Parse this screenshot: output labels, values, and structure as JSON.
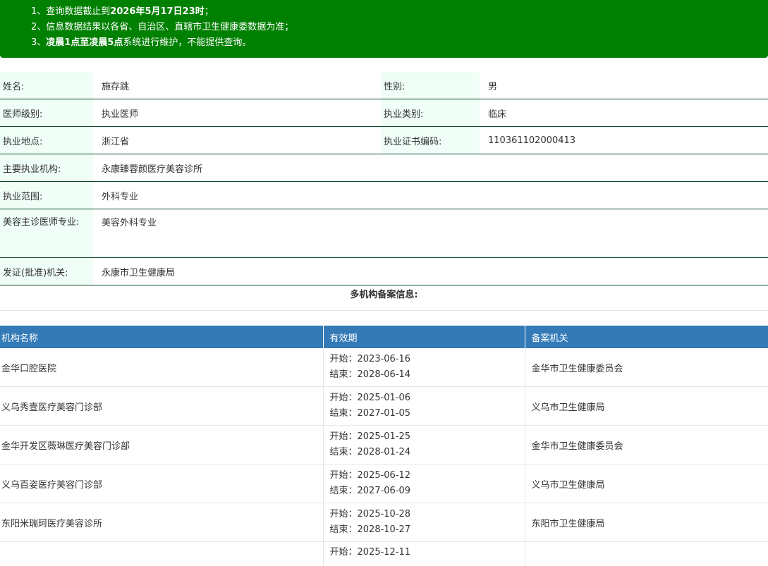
{
  "notice": {
    "line1_prefix": "1、查询数据截止到",
    "line1_bold": "2026年5月17日23时",
    "line1_suffix": "；",
    "line2": "2、信息数据结果以各省、自治区、直辖市卫生健康委数据为准；",
    "line3_prefix": "3、",
    "line3_bold": "凌晨1点至凌晨5点",
    "line3_suffix": "系统进行维护，不能提供查询。"
  },
  "doctor": {
    "name_label": "姓名:",
    "name": "施存跳",
    "gender_label": "性别:",
    "gender": "男",
    "level_label": "医师级别:",
    "level": "执业医师",
    "category_label": "执业类别:",
    "category": "临床",
    "location_label": "执业地点:",
    "location": "浙江省",
    "cert_label": "执业证书编码:",
    "cert": "110361102000413",
    "institution_label": "主要执业机构:",
    "institution": "永康臻蓉颜医疗美容诊所",
    "scope_label": "执业范围:",
    "scope": "外科专业",
    "cosmetic_label": "美容主诊医师专业:",
    "cosmetic": "美容外科专业",
    "issuer_label": "发证(批准)机关:",
    "issuer": "永康市卫生健康局"
  },
  "multi": {
    "title": "多机构备案信息:",
    "headers": {
      "name": "机构名称",
      "period": "有效期",
      "authority": "备案机关"
    },
    "rows": [
      {
        "name": "金华口腔医院",
        "start": "开始：2023-06-16",
        "end": "结束：2028-06-14",
        "authority": "金华市卫生健康委员会"
      },
      {
        "name": "义乌秀壹医疗美容门诊部",
        "start": "开始：2025-01-06",
        "end": "结束：2027-01-05",
        "authority": "义乌市卫生健康局"
      },
      {
        "name": "金华开发区薇琳医疗美容门诊部",
        "start": "开始：2025-01-25",
        "end": "结束：2028-01-24",
        "authority": "金华市卫生健康委员会"
      },
      {
        "name": "义乌百姿医疗美容门诊部",
        "start": "开始：2025-06-12",
        "end": "结束：2027-06-09",
        "authority": "义乌市卫生健康局"
      },
      {
        "name": "东阳米瑞珂医疗美容诊所",
        "start": "开始：2025-10-28",
        "end": "结束：2028-10-27",
        "authority": "东阳市卫生健康局"
      },
      {
        "name": "",
        "start": "开始：2025-12-11",
        "end": "",
        "authority": ""
      }
    ]
  }
}
